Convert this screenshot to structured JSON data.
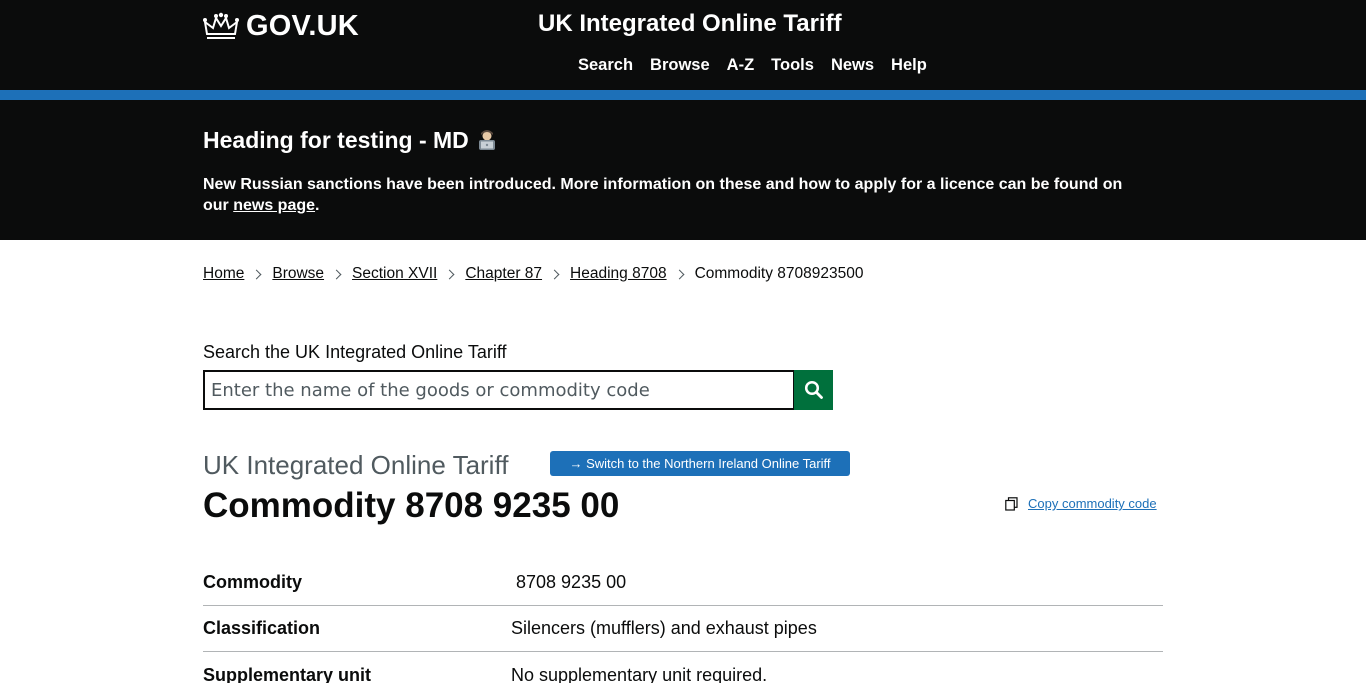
{
  "header": {
    "logo_text": "GOV.UK",
    "service_name": "UK Integrated Online Tariff",
    "nav": [
      {
        "label": "Search"
      },
      {
        "label": "Browse"
      },
      {
        "label": "A-Z"
      },
      {
        "label": "Tools"
      },
      {
        "label": "News"
      },
      {
        "label": "Help"
      }
    ],
    "colors": {
      "background": "#0b0c0c",
      "accent_bar": "#1d70b8"
    }
  },
  "banner": {
    "heading": "Heading for testing - MD",
    "heading_icon": "person-at-computer-icon",
    "text_before_link": "New Russian sanctions have been introduced. More information on these and how to apply for a licence can be found on our ",
    "link_text": "news page",
    "text_after_link": "."
  },
  "breadcrumb": {
    "items": [
      {
        "label": "Home"
      },
      {
        "label": "Browse"
      },
      {
        "label": "Section XVII"
      },
      {
        "label": "Chapter 87"
      },
      {
        "label": "Heading 8708"
      }
    ],
    "current": "Commodity 8708923500"
  },
  "search": {
    "label": "Search the UK Integrated Online Tariff",
    "placeholder": "Enter the name of the goods or commodity code",
    "value": "",
    "button_icon": "search-icon",
    "button_color": "#00703c"
  },
  "main": {
    "caption": "UK Integrated Online Tariff",
    "switch_button_label": "→ Switch to the Northern Ireland Online Tariff",
    "title": "Commodity 8708 9235 00",
    "copy_link_label": "Copy commodity code",
    "copy_icon": "copy-icon",
    "link_color": "#1d70b8"
  },
  "summary": {
    "rows": [
      {
        "key": "Commodity",
        "value": " 8708 9235 00"
      },
      {
        "key": "Classification",
        "value": "Silencers (mufflers) and exhaust pipes"
      },
      {
        "key": "Supplementary unit",
        "value": "No supplementary unit required."
      }
    ]
  }
}
